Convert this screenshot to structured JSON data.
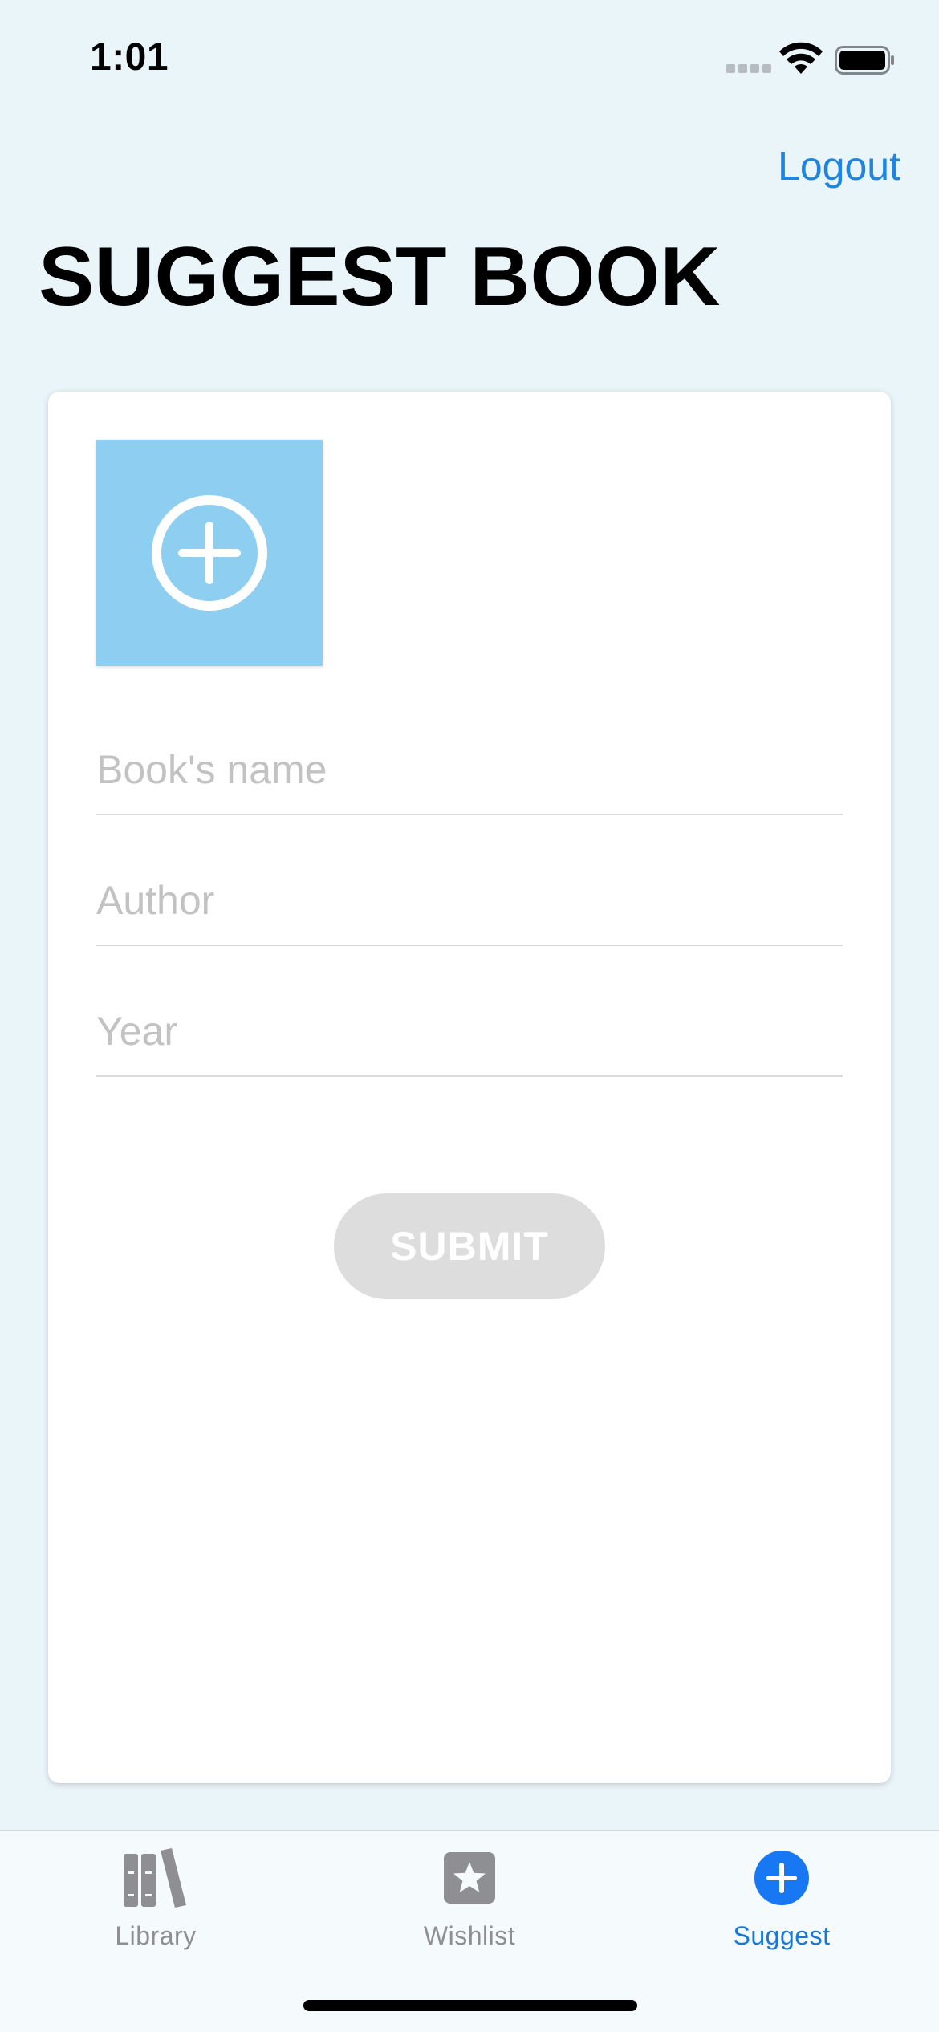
{
  "status_bar": {
    "time": "1:01"
  },
  "header": {
    "logout_label": "Logout",
    "title": "SUGGEST BOOK"
  },
  "form": {
    "image_picker_icon": "add-circle-icon",
    "book_name": {
      "value": "",
      "placeholder": "Book's name"
    },
    "author": {
      "value": "",
      "placeholder": "Author"
    },
    "year": {
      "value": "",
      "placeholder": "Year"
    },
    "submit_label": "SUBMIT"
  },
  "tabs": [
    {
      "label": "Library",
      "icon": "books-icon",
      "active": false
    },
    {
      "label": "Wishlist",
      "icon": "star-icon",
      "active": false
    },
    {
      "label": "Suggest",
      "icon": "plus-circle-icon",
      "active": true
    }
  ],
  "colors": {
    "background": "#EAF5FA",
    "accent": "#1E86E0",
    "image_picker": "#8DCEF1",
    "submit_disabled": "#DDDDDD",
    "tab_inactive": "#8E8E93"
  }
}
